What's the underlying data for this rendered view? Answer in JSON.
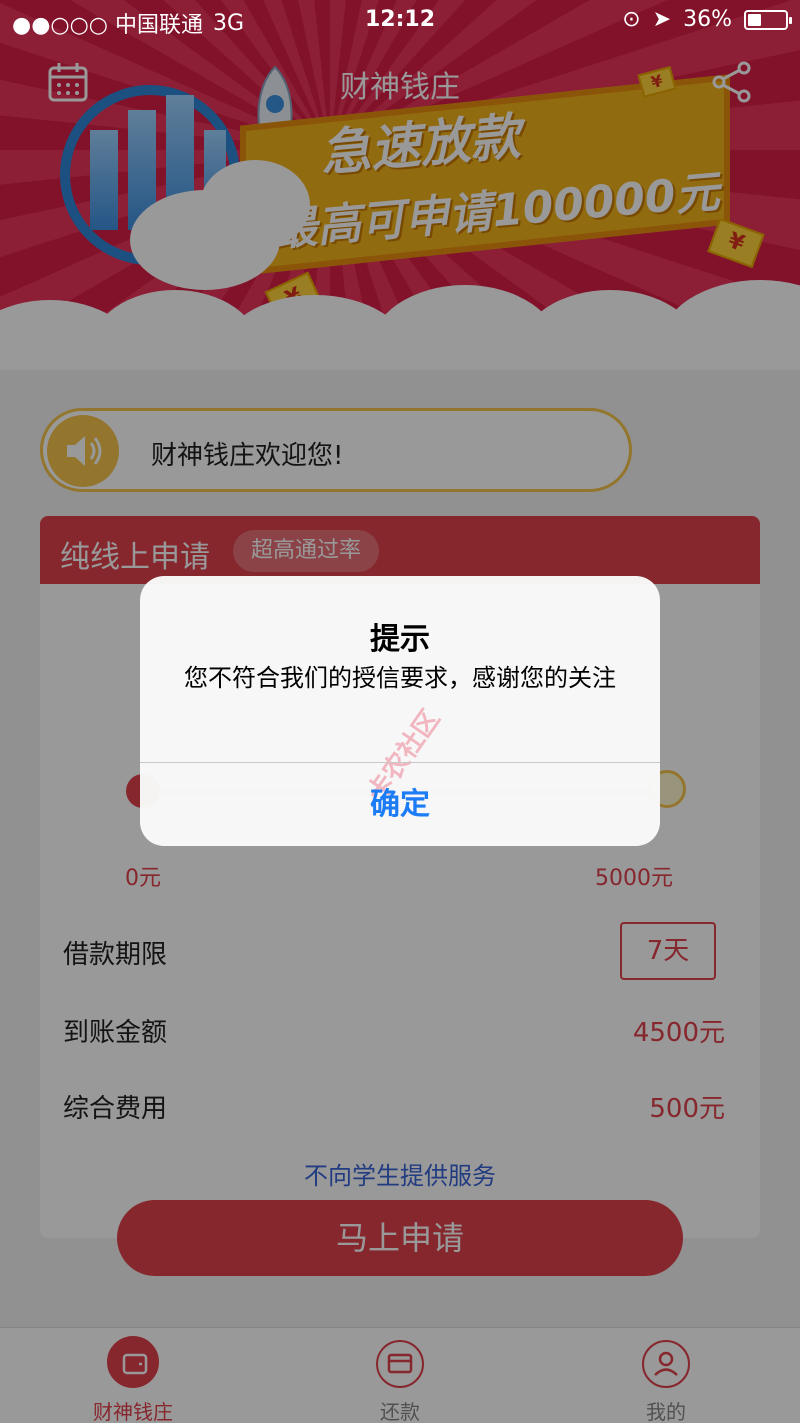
{
  "status_bar": {
    "carrier": "●●○○○ 中国联通",
    "network": "3G",
    "time": "12:12",
    "battery": "36%",
    "battery_level": 0.36
  },
  "header": {
    "title": "财神钱庄",
    "left_icon": "calendar-icon",
    "right_icon": "share-icon"
  },
  "banner": {
    "line1": "急速放款",
    "line2": "最高可申请100000元",
    "note_symbol": "¥"
  },
  "notice": {
    "text": "财神钱庄欢迎您!"
  },
  "card": {
    "title": "纯线上申请",
    "badge": "超高通过率",
    "min_label": "0元",
    "max_label": "5000元",
    "rows": [
      {
        "label": "借款期限",
        "value": "7天"
      },
      {
        "label": "到账金额",
        "value": "4500元"
      },
      {
        "label": "综合费用",
        "value": "500元"
      }
    ],
    "student_note": "不向学生提供服务",
    "apply_button": "马上申请"
  },
  "tabbar": {
    "items": [
      {
        "label": "财神钱庄",
        "icon": "wallet-icon",
        "active": true
      },
      {
        "label": "还款",
        "icon": "card-icon",
        "active": false
      },
      {
        "label": "我的",
        "icon": "user-icon",
        "active": false
      }
    ]
  },
  "alert": {
    "title": "提示",
    "message": "您不符合我们的授信要求，感谢您的关注",
    "confirm": "确定",
    "watermark": "卡农社区"
  },
  "colors": {
    "brand_red": "#e0414c",
    "alert_button_blue": "#1b7cf5",
    "gold": "#f5c44c"
  }
}
